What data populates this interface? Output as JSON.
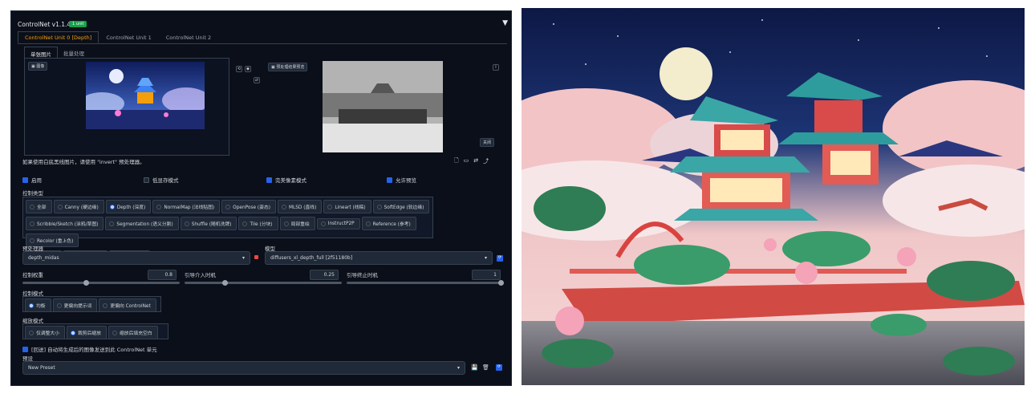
{
  "header": {
    "title": "ControlNet v1.1.406",
    "badge": "1 unit",
    "collapse": "▼"
  },
  "unit_tabs": [
    "ControlNet Unit 0 [Depth]",
    "ControlNet Unit 1",
    "ControlNet Unit 2"
  ],
  "sub_tabs": [
    "单张图片",
    "批量处理"
  ],
  "image_panel": {
    "upload_label": "图像",
    "preview_label": "预处理结果预览",
    "close_label": "关闭"
  },
  "note": "如果使用白底黑线图片，请使用 \"invert\" 预处理器。",
  "checkboxes": [
    {
      "label": "启用",
      "checked": true
    },
    {
      "label": "低显存模式",
      "checked": false
    },
    {
      "label": "完美像素模式",
      "checked": true
    },
    {
      "label": "允许预览",
      "checked": true
    }
  ],
  "control_type": {
    "label": "控制类型",
    "row1": [
      "全部",
      "Canny (硬边缘)",
      "Depth (深度)",
      "NormalMap (法线贴图)",
      "OpenPose (姿态)",
      "MLSD (直线)",
      "Lineart (线稿)",
      "SoftEdge (软边缘)"
    ],
    "row2": [
      "Scribble/Sketch (涂鸦/草图)",
      "Segmentation (语义分割)",
      "Shuffle (随机洗牌)",
      "Tile (分块)",
      "局部重绘",
      "InstructP2P",
      "Reference (参考)",
      "Recolor (重上色)"
    ],
    "row3": [
      "Revision",
      "T2I-Adapter",
      "IP-Adapter"
    ],
    "selected": "Depth (深度)"
  },
  "preprocessor": {
    "label": "预处理器",
    "value": "depth_midas"
  },
  "model": {
    "label": "模型",
    "value": "diffusers_xl_depth_full [2f51180b]"
  },
  "sliders": [
    {
      "label": "控制权重",
      "value": "0.8",
      "fraction": 0.4
    },
    {
      "label": "引导介入时机",
      "value": "0.25",
      "fraction": 0.25
    },
    {
      "label": "引导终止时机",
      "value": "1",
      "fraction": 1.0
    }
  ],
  "control_mode": {
    "label": "控制模式",
    "options": [
      "均衡",
      "更偏向提示词",
      "更偏向 ControlNet"
    ],
    "selected": "均衡"
  },
  "resize_mode": {
    "label": "缩放模式",
    "options": [
      "仅调整大小",
      "裁剪后缩放",
      "缩放后填充空白"
    ],
    "selected": "裁剪后缩放"
  },
  "loopback": {
    "label": "[回送] 自动将生成后的图像发送到此 ControlNet 单元",
    "checked": true
  },
  "preset": {
    "label": "预设",
    "value": "New Preset"
  },
  "colors": {
    "panel_bg": "#0b0f19",
    "accent": "#2563eb",
    "tab_active": "#f59e0b",
    "badge": "#16a34a"
  }
}
